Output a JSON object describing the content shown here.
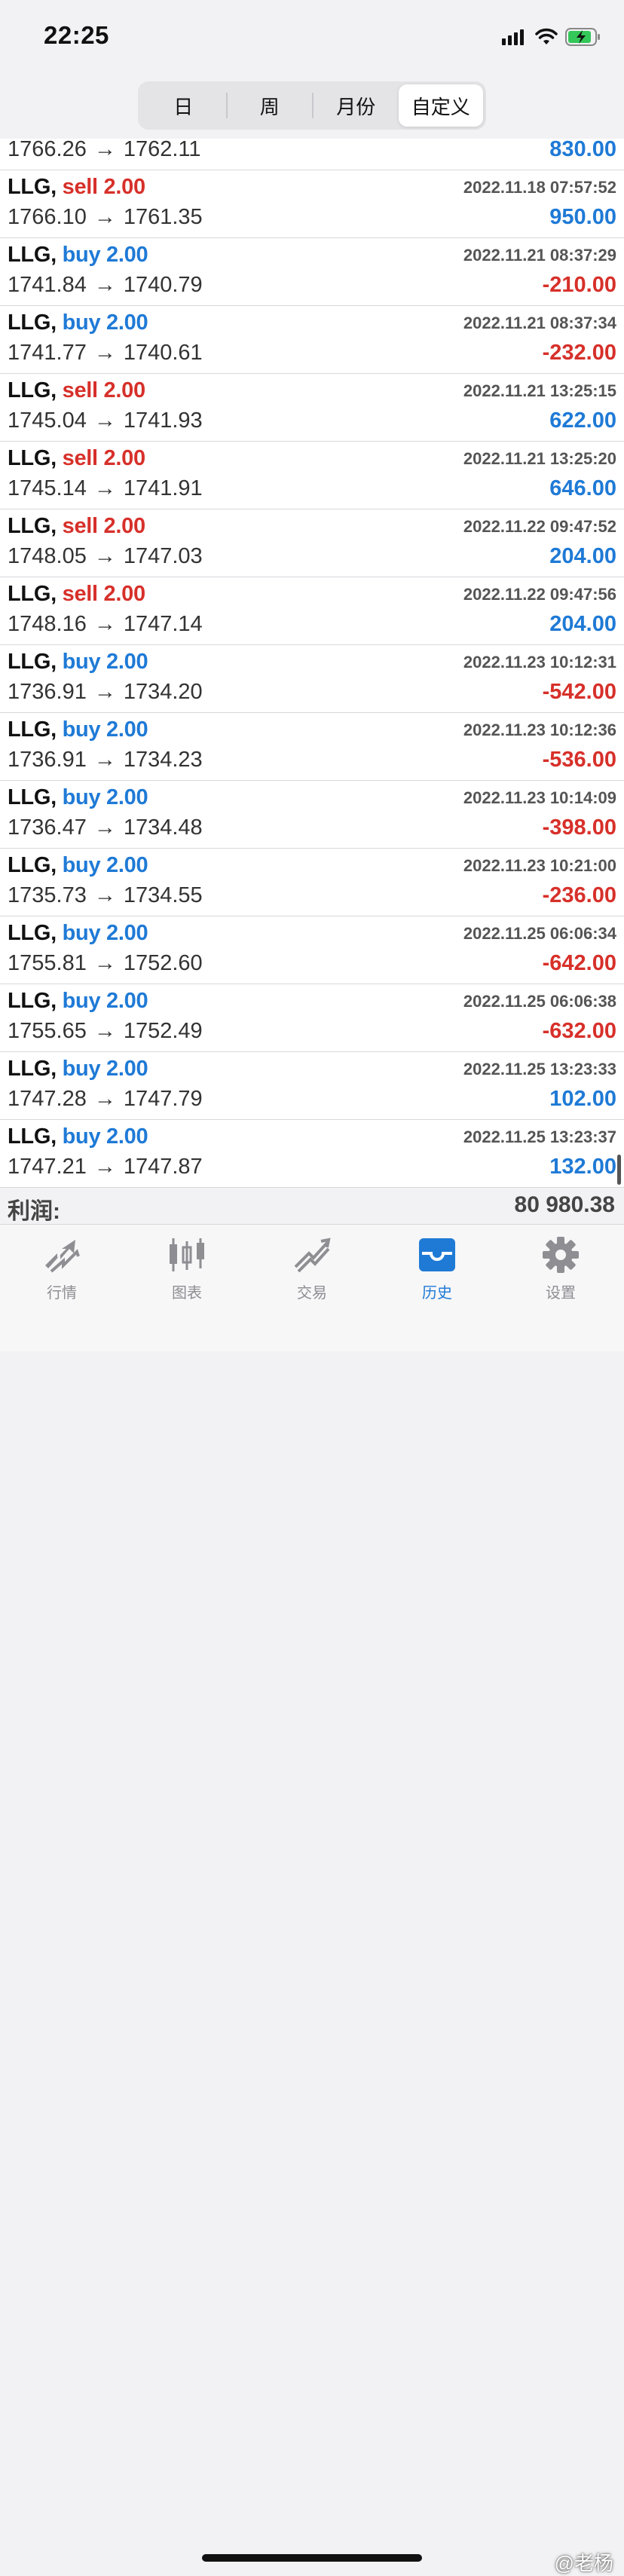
{
  "status": {
    "time": "22:25"
  },
  "segmented": {
    "options": [
      "日",
      "周",
      "月份",
      "自定义"
    ],
    "selected": "自定义"
  },
  "first_partial": {
    "open": "1766.26",
    "close": "1762.11",
    "profit": "830.00"
  },
  "trades": [
    {
      "symbol": "LLG,",
      "side": "sell",
      "volume": "2.00",
      "datetime": "2022.11.18 07:57:52",
      "open": "1766.10",
      "close": "1761.35",
      "profit": "950.00"
    },
    {
      "symbol": "LLG,",
      "side": "buy",
      "volume": "2.00",
      "datetime": "2022.11.21 08:37:29",
      "open": "1741.84",
      "close": "1740.79",
      "profit": "-210.00"
    },
    {
      "symbol": "LLG,",
      "side": "buy",
      "volume": "2.00",
      "datetime": "2022.11.21 08:37:34",
      "open": "1741.77",
      "close": "1740.61",
      "profit": "-232.00"
    },
    {
      "symbol": "LLG,",
      "side": "sell",
      "volume": "2.00",
      "datetime": "2022.11.21 13:25:15",
      "open": "1745.04",
      "close": "1741.93",
      "profit": "622.00"
    },
    {
      "symbol": "LLG,",
      "side": "sell",
      "volume": "2.00",
      "datetime": "2022.11.21 13:25:20",
      "open": "1745.14",
      "close": "1741.91",
      "profit": "646.00"
    },
    {
      "symbol": "LLG,",
      "side": "sell",
      "volume": "2.00",
      "datetime": "2022.11.22 09:47:52",
      "open": "1748.05",
      "close": "1747.03",
      "profit": "204.00"
    },
    {
      "symbol": "LLG,",
      "side": "sell",
      "volume": "2.00",
      "datetime": "2022.11.22 09:47:56",
      "open": "1748.16",
      "close": "1747.14",
      "profit": "204.00"
    },
    {
      "symbol": "LLG,",
      "side": "buy",
      "volume": "2.00",
      "datetime": "2022.11.23 10:12:31",
      "open": "1736.91",
      "close": "1734.20",
      "profit": "-542.00"
    },
    {
      "symbol": "LLG,",
      "side": "buy",
      "volume": "2.00",
      "datetime": "2022.11.23 10:12:36",
      "open": "1736.91",
      "close": "1734.23",
      "profit": "-536.00"
    },
    {
      "symbol": "LLG,",
      "side": "buy",
      "volume": "2.00",
      "datetime": "2022.11.23 10:14:09",
      "open": "1736.47",
      "close": "1734.48",
      "profit": "-398.00"
    },
    {
      "symbol": "LLG,",
      "side": "buy",
      "volume": "2.00",
      "datetime": "2022.11.23 10:21:00",
      "open": "1735.73",
      "close": "1734.55",
      "profit": "-236.00"
    },
    {
      "symbol": "LLG,",
      "side": "buy",
      "volume": "2.00",
      "datetime": "2022.11.25 06:06:34",
      "open": "1755.81",
      "close": "1752.60",
      "profit": "-642.00"
    },
    {
      "symbol": "LLG,",
      "side": "buy",
      "volume": "2.00",
      "datetime": "2022.11.25 06:06:38",
      "open": "1755.65",
      "close": "1752.49",
      "profit": "-632.00"
    },
    {
      "symbol": "LLG,",
      "side": "buy",
      "volume": "2.00",
      "datetime": "2022.11.25 13:23:33",
      "open": "1747.28",
      "close": "1747.79",
      "profit": "102.00"
    },
    {
      "symbol": "LLG,",
      "side": "buy",
      "volume": "2.00",
      "datetime": "2022.11.25 13:23:37",
      "open": "1747.21",
      "close": "1747.87",
      "profit": "132.00"
    }
  ],
  "arrow": "→",
  "summary": {
    "label": "利润:",
    "value": "80 980.38"
  },
  "tabbar": {
    "items": [
      {
        "label": "行情",
        "icon": "quotes-icon"
      },
      {
        "label": "图表",
        "icon": "chart-candles-icon"
      },
      {
        "label": "交易",
        "icon": "trade-icon"
      },
      {
        "label": "历史",
        "icon": "history-inbox-icon"
      },
      {
        "label": "设置",
        "icon": "gear-icon"
      }
    ],
    "active": "历史"
  },
  "watermark": "@老杨",
  "colors": {
    "sell": "#d7302a",
    "buy": "#1f7ad6",
    "positive": "#1f7ad6",
    "negative": "#d7302a",
    "active_tab": "#1f7ad6"
  }
}
